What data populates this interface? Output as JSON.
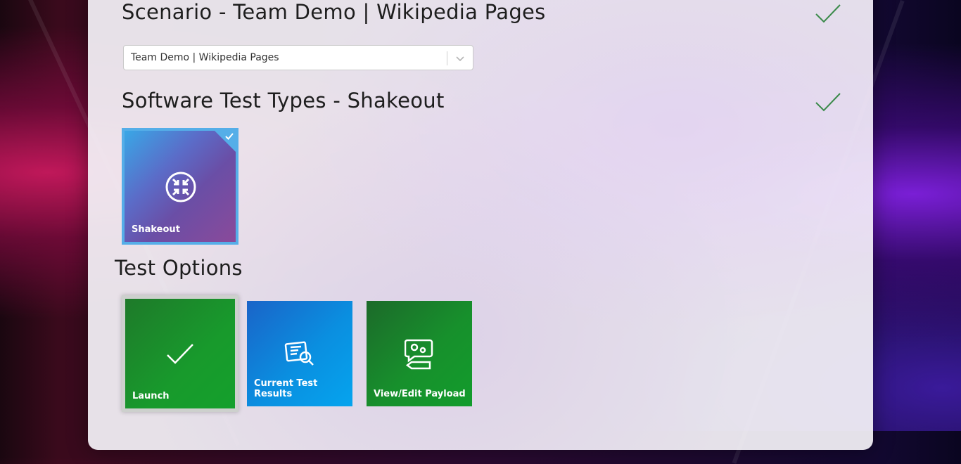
{
  "scenario": {
    "title": "Scenario - Team Demo | Wikipedia Pages",
    "selected_value": "Team Demo | Wikipedia Pages"
  },
  "test_types": {
    "title": "Software Test Types - Shakeout",
    "tiles": [
      {
        "label": "Shakeout",
        "icon": "compress-arrows-icon",
        "selected": true
      }
    ]
  },
  "test_options": {
    "title": "Test Options",
    "tiles": [
      {
        "label": "Launch",
        "icon": "checkmark-icon"
      },
      {
        "label": "Current Test Results",
        "icon": "document-search-icon"
      },
      {
        "label": "View/Edit Payload",
        "icon": "chat-gears-icon"
      }
    ]
  },
  "colors": {
    "check_green": "#3a8a4a",
    "selected_border": "#55aee8",
    "launch_green": "#189a2c",
    "results_blue": "#0a8fe0"
  }
}
